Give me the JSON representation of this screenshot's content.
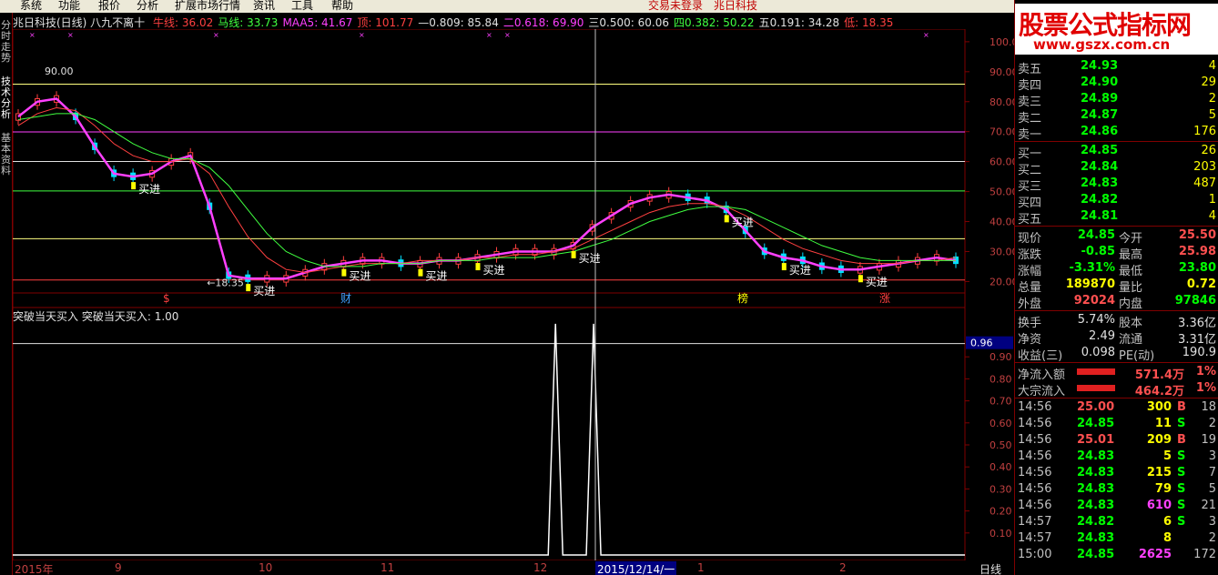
{
  "menu": {
    "items": [
      "系统",
      "功能",
      "报价",
      "分析",
      "扩展市场行情",
      "资讯",
      "工具",
      "帮助"
    ],
    "status_center": "交易未登录",
    "status_stock": "兆日科技"
  },
  "left_tabs": [
    "分时走势",
    "技术分析",
    "基本资料"
  ],
  "main_chart": {
    "title": "兆日科技(日线) 八九不离十",
    "indicators": [
      {
        "label": "牛线:",
        "value": "36.02",
        "color": "#ff4040"
      },
      {
        "label": "马线:",
        "value": "33.73",
        "color": "#40ff40"
      },
      {
        "label": "MAA5:",
        "value": "41.67",
        "color": "#ff40ff"
      },
      {
        "label": "顶:",
        "value": "101.77",
        "color": "#ff4040"
      },
      {
        "label": "—0.809:",
        "value": "85.84",
        "color": "#e0e0e0"
      },
      {
        "label": "二0.618:",
        "value": "69.90",
        "color": "#ff40ff"
      },
      {
        "label": "三0.500:",
        "value": "60.06",
        "color": "#e0e0e0"
      },
      {
        "label": "四0.382:",
        "value": "50.22",
        "color": "#40ff40"
      },
      {
        "label": "五0.191:",
        "value": "34.28",
        "color": "#e0e0e0"
      },
      {
        "label": "低:",
        "value": "18.35",
        "color": "#ff4040"
      }
    ],
    "y_ticks": [
      "100.00",
      "90.00",
      "80.00",
      "70.00",
      "60.00",
      "50.00",
      "40.00",
      "30.00",
      "20.00"
    ],
    "high_label": "90.00",
    "low_label": "←18.35",
    "buy_label": "买进",
    "buy_count": 9,
    "event_labels": [
      "$",
      "财",
      "榜",
      "涨"
    ],
    "fib_levels": [
      85.84,
      69.9,
      60.06,
      50.22,
      34.28
    ]
  },
  "chart_data": {
    "type": "line",
    "title": "兆日科技(日线)",
    "ylim": [
      18,
      103
    ],
    "x_labels": [
      "2015年",
      "9",
      "10",
      "11",
      "12",
      "2015/12/14/一",
      "1",
      "2"
    ],
    "series": [
      {
        "name": "MAA5",
        "values": [
          75,
          80,
          81,
          75,
          65,
          56,
          55,
          56,
          60,
          62,
          45,
          22,
          21,
          21,
          21,
          23,
          25,
          26,
          27,
          27,
          26,
          26,
          27,
          27,
          28,
          29,
          30,
          30,
          30,
          32,
          38,
          42,
          46,
          48,
          49,
          48,
          47,
          44,
          37,
          30,
          28,
          27,
          25,
          24,
          24,
          25,
          26,
          27,
          28,
          27
        ]
      },
      {
        "name": "牛线",
        "values": [
          72,
          76,
          78,
          77,
          72,
          66,
          62,
          60,
          60,
          61,
          56,
          45,
          35,
          28,
          24,
          23,
          24,
          25,
          26,
          26,
          26,
          27,
          27,
          27,
          28,
          28,
          29,
          29,
          30,
          31,
          34,
          37,
          40,
          43,
          45,
          46,
          46,
          45,
          42,
          38,
          34,
          31,
          29,
          27,
          26,
          26,
          26,
          27,
          27,
          28
        ]
      },
      {
        "name": "马线",
        "values": [
          74,
          75,
          76,
          76,
          74,
          70,
          66,
          63,
          61,
          61,
          58,
          52,
          44,
          36,
          30,
          27,
          25,
          25,
          25,
          26,
          26,
          26,
          27,
          27,
          27,
          28,
          28,
          28,
          29,
          30,
          32,
          34,
          37,
          40,
          42,
          44,
          45,
          45,
          44,
          41,
          38,
          35,
          32,
          30,
          28,
          27,
          27,
          27,
          27,
          27
        ]
      }
    ],
    "sub_indicator": {
      "name": "突破当天买入",
      "label": "突破当天买入",
      "value": "1.00",
      "y_ticks": [
        "0.90",
        "0.80",
        "0.70",
        "0.60",
        "0.50",
        "0.40",
        "0.30",
        "0.20",
        "0.10"
      ],
      "y_highlight": "0.96",
      "pulse_positions": [
        0.57,
        0.61
      ]
    }
  },
  "period_label": "日线",
  "watermark": {
    "title": "股票公式指标网",
    "url": "www.gszx.com.cn"
  },
  "order_book": {
    "asks": [
      {
        "label": "卖五",
        "price": "24.93",
        "vol": "4"
      },
      {
        "label": "卖四",
        "price": "24.90",
        "vol": "29"
      },
      {
        "label": "卖三",
        "price": "24.89",
        "vol": "2"
      },
      {
        "label": "卖二",
        "price": "24.87",
        "vol": "5"
      },
      {
        "label": "卖一",
        "price": "24.86",
        "vol": "176"
      }
    ],
    "bids": [
      {
        "label": "买一",
        "price": "24.85",
        "vol": "26"
      },
      {
        "label": "买二",
        "price": "24.84",
        "vol": "203"
      },
      {
        "label": "买三",
        "price": "24.83",
        "vol": "487"
      },
      {
        "label": "买四",
        "price": "24.82",
        "vol": "1"
      },
      {
        "label": "买五",
        "price": "24.81",
        "vol": "4"
      }
    ]
  },
  "quote": [
    {
      "l1": "现价",
      "v1": "24.85",
      "c1": "c-green",
      "l2": "今开",
      "v2": "25.50",
      "c2": "c-red"
    },
    {
      "l1": "涨跌",
      "v1": "-0.85",
      "c1": "c-green",
      "l2": "最高",
      "v2": "25.98",
      "c2": "c-red"
    },
    {
      "l1": "涨幅",
      "v1": "-3.31%",
      "c1": "c-green",
      "l2": "最低",
      "v2": "23.80",
      "c2": "c-green"
    },
    {
      "l1": "总量",
      "v1": "189870",
      "c1": "c-yel",
      "l2": "量比",
      "v2": "0.72",
      "c2": "c-yel"
    },
    {
      "l1": "外盘",
      "v1": "92024",
      "c1": "c-red",
      "l2": "内盘",
      "v2": "97846",
      "c2": "c-green"
    }
  ],
  "fundamentals": [
    {
      "l1": "换手",
      "v1": "5.74%",
      "l2": "股本",
      "v2": "3.36亿"
    },
    {
      "l1": "净资",
      "v1": "2.49",
      "l2": "流通",
      "v2": "3.31亿"
    },
    {
      "l1": "收益(三)",
      "v1": "0.098",
      "l2": "PE(动)",
      "v2": "190.9"
    }
  ],
  "flows": [
    {
      "label": "净流入额",
      "value": "571.4万",
      "pct": "1%",
      "bar": 0.75
    },
    {
      "label": "大宗流入",
      "value": "464.2万",
      "pct": "1%",
      "bar": 0.75
    }
  ],
  "ticks": [
    {
      "time": "14:56",
      "price": "25.00",
      "pc": "c-red",
      "vol": "300",
      "vc": "c-yel",
      "bs": "B",
      "bc": "c-red",
      "n": "18"
    },
    {
      "time": "14:56",
      "price": "24.85",
      "pc": "c-green",
      "vol": "11",
      "vc": "c-yel",
      "bs": "S",
      "bc": "c-green",
      "n": "2"
    },
    {
      "time": "14:56",
      "price": "25.01",
      "pc": "c-red",
      "vol": "209",
      "vc": "c-yel",
      "bs": "B",
      "bc": "c-red",
      "n": "19"
    },
    {
      "time": "14:56",
      "price": "24.83",
      "pc": "c-green",
      "vol": "5",
      "vc": "c-yel",
      "bs": "S",
      "bc": "c-green",
      "n": "3"
    },
    {
      "time": "14:56",
      "price": "24.83",
      "pc": "c-green",
      "vol": "215",
      "vc": "c-yel",
      "bs": "S",
      "bc": "c-green",
      "n": "7"
    },
    {
      "time": "14:56",
      "price": "24.83",
      "pc": "c-green",
      "vol": "79",
      "vc": "c-yel",
      "bs": "S",
      "bc": "c-green",
      "n": "5"
    },
    {
      "time": "14:56",
      "price": "24.83",
      "pc": "c-green",
      "vol": "610",
      "vc": "c-mag",
      "bs": "S",
      "bc": "c-green",
      "n": "21"
    },
    {
      "time": "14:57",
      "price": "24.82",
      "pc": "c-green",
      "vol": "6",
      "vc": "c-yel",
      "bs": "S",
      "bc": "c-green",
      "n": "3"
    },
    {
      "time": "14:57",
      "price": "24.83",
      "pc": "c-green",
      "vol": "8",
      "vc": "c-yel",
      "bs": "",
      "bc": "c-green",
      "n": "2"
    },
    {
      "time": "15:00",
      "price": "24.85",
      "pc": "c-green",
      "vol": "2625",
      "vc": "c-mag",
      "bs": "",
      "bc": "c-green",
      "n": "172"
    }
  ]
}
